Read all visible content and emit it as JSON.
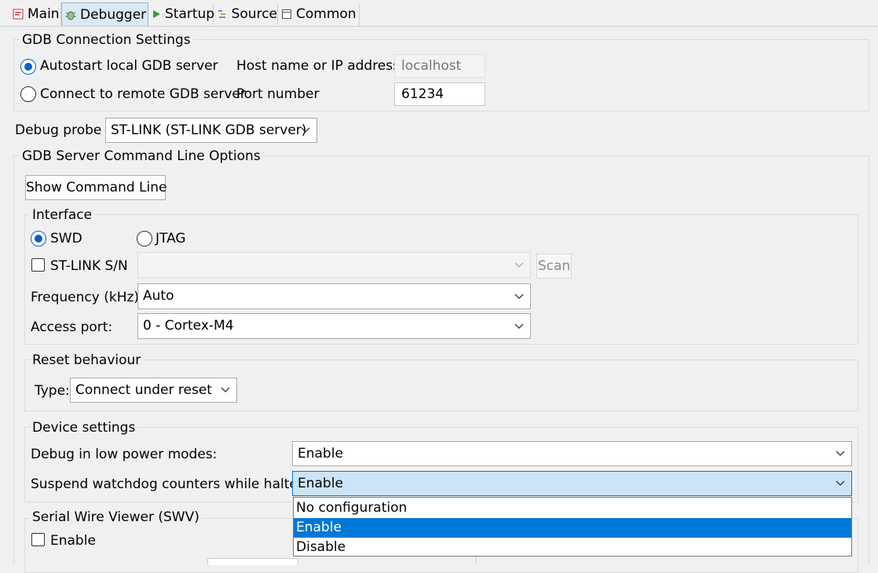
{
  "tabs": [
    {
      "label": "Main",
      "icon": "main-config-icon"
    },
    {
      "label": "Debugger",
      "icon": "debugger-bug-icon",
      "active": true
    },
    {
      "label": "Startup",
      "icon": "play-icon"
    },
    {
      "label": "Source",
      "icon": "source-lookup-icon"
    },
    {
      "label": "Common",
      "icon": "common-tab-icon"
    }
  ],
  "gdb_connection": {
    "title": "GDB Connection Settings",
    "autostart_label": "Autostart local GDB server",
    "remote_label": "Connect to remote GDB server",
    "host_label": "Host name or IP address",
    "host_value": "localhost",
    "port_label": "Port number",
    "port_value": "61234"
  },
  "debug_probe": {
    "label": "Debug probe",
    "value": "ST-LINK (ST-LINK GDB server)"
  },
  "server_options": {
    "title": "GDB Server Command Line Options",
    "show_cmd_button": "Show Command Line"
  },
  "interface": {
    "title": "Interface",
    "swd_label": "SWD",
    "jtag_label": "JTAG",
    "stlink_sn_label": "ST-LINK S/N",
    "stlink_sn_value": "",
    "scan_button": "Scan",
    "frequency_label": "Frequency (kHz):",
    "frequency_value": "Auto",
    "access_port_label": "Access port:",
    "access_port_value": "0 - Cortex-M4"
  },
  "reset": {
    "title": "Reset behaviour",
    "type_label": "Type:",
    "type_value": "Connect under reset"
  },
  "device": {
    "title": "Device settings",
    "low_power_label": "Debug in low power modes:",
    "low_power_value": "Enable",
    "watchdog_label": "Suspend watchdog counters while halted:",
    "watchdog_value": "Enable"
  },
  "dropdown_options": [
    "No configuration",
    "Enable",
    "Disable"
  ],
  "swv": {
    "title": "Serial Wire Viewer (SWV)",
    "enable_label": "Enable"
  },
  "colors": {
    "accent": "#0078d7",
    "selection": "#0078d7",
    "focused_combo": "#cce4f7"
  }
}
